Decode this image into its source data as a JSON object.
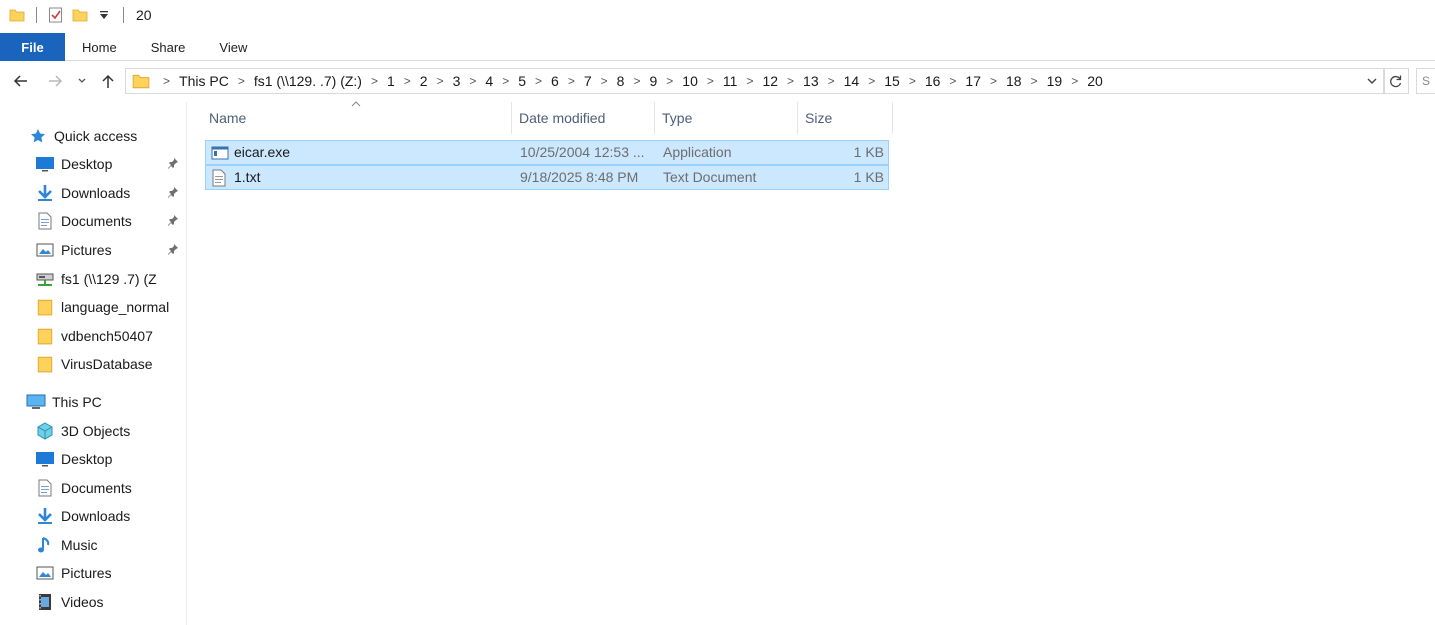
{
  "window": {
    "title": "20"
  },
  "quick_access_toolbar": {
    "icons": [
      "folder-icon",
      "properties-check-icon",
      "new-folder-icon",
      "customize-dropdown-icon"
    ]
  },
  "ribbon": {
    "tabs": [
      "File",
      "Home",
      "Share",
      "View"
    ],
    "active_color": "#1a64be"
  },
  "navigation": {
    "back": "back-arrow-icon",
    "forward": "forward-arrow-icon",
    "recent": "recent-locations-icon",
    "up": "up-arrow-icon"
  },
  "address_bar": {
    "crumbs": [
      "This PC",
      "fs1 (\\\\129.      .7) (Z:)",
      "1",
      "2",
      "3",
      "4",
      "5",
      "6",
      "7",
      "8",
      "9",
      "10",
      "11",
      "12",
      "13",
      "14",
      "15",
      "16",
      "17",
      "18",
      "19",
      "20"
    ]
  },
  "search": {
    "placeholder": "S"
  },
  "sidebar": {
    "quick_access": {
      "label": "Quick access",
      "items": [
        {
          "label": "Desktop",
          "icon": "desktop-icon",
          "pinned": true
        },
        {
          "label": "Downloads",
          "icon": "downloads-icon",
          "pinned": true
        },
        {
          "label": "Documents",
          "icon": "documents-icon",
          "pinned": true
        },
        {
          "label": "Pictures",
          "icon": "pictures-icon",
          "pinned": true
        },
        {
          "label": "fs1 (\\\\129      .7) (Z",
          "icon": "network-drive-icon",
          "pinned": false
        },
        {
          "label": "language_normal",
          "icon": "folder-icon",
          "pinned": false
        },
        {
          "label": "vdbench50407",
          "icon": "folder-icon",
          "pinned": false
        },
        {
          "label": "VirusDatabase",
          "icon": "folder-icon",
          "pinned": false
        }
      ]
    },
    "this_pc": {
      "label": "This PC",
      "items": [
        {
          "label": "3D Objects",
          "icon": "3d-objects-icon"
        },
        {
          "label": "Desktop",
          "icon": "desktop-icon"
        },
        {
          "label": "Documents",
          "icon": "documents-icon"
        },
        {
          "label": "Downloads",
          "icon": "downloads-icon"
        },
        {
          "label": "Music",
          "icon": "music-icon"
        },
        {
          "label": "Pictures",
          "icon": "pictures-icon"
        },
        {
          "label": "Videos",
          "icon": "videos-icon"
        }
      ]
    }
  },
  "file_list": {
    "columns": [
      "Name",
      "Date modified",
      "Type",
      "Size"
    ],
    "rows": [
      {
        "name": "eicar.exe",
        "date": "10/25/2004 12:53 ...",
        "type": "Application",
        "size": "1 KB",
        "icon": "application-icon",
        "selected": true
      },
      {
        "name": "1.txt",
        "date": "9/18/2025 8:48 PM",
        "type": "Text Document",
        "size": "1 KB",
        "icon": "text-document-icon",
        "selected": true
      }
    ],
    "selection_color": "#cce8ff"
  }
}
